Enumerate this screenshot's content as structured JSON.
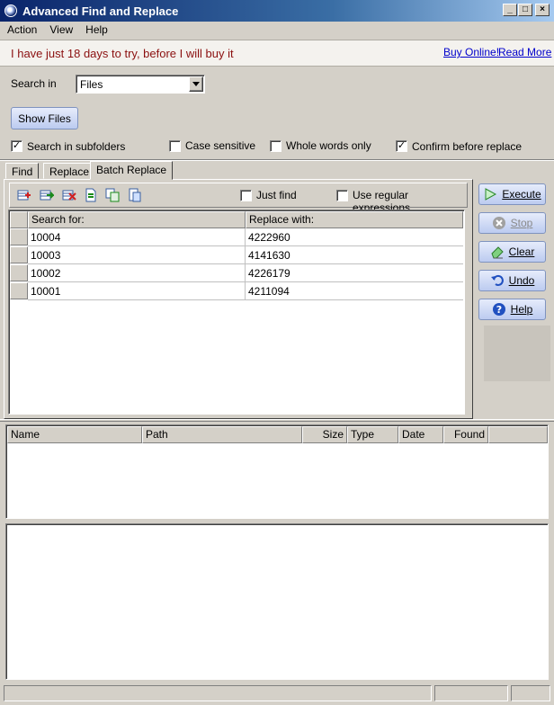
{
  "window": {
    "title": "Advanced Find and Replace"
  },
  "menu": [
    "Action",
    "View",
    "Help"
  ],
  "promo": {
    "text": "I have just 18 days to try, before I will buy it",
    "buy_link": "Buy Online!",
    "read_link": "Read More"
  },
  "search": {
    "label": "Search in",
    "value": "Files",
    "show_files": "Show Files"
  },
  "options": {
    "subfolders": "Search in subfolders",
    "case_sensitive": "Case sensitive",
    "whole_words": "Whole words only",
    "confirm": "Confirm before replace",
    "subfolders_checked": true,
    "case_checked": false,
    "whole_checked": false,
    "confirm_checked": true
  },
  "tabs": [
    "Find",
    "Replace",
    "Batch Replace"
  ],
  "active_tab": "Batch Replace",
  "batch": {
    "just_find": "Just find",
    "regex": "Use regular expressions",
    "col_search": "Search for:",
    "col_replace": "Replace with:",
    "rows": [
      {
        "search": "10004",
        "replace": "4222960"
      },
      {
        "search": "10003",
        "replace": "4141630"
      },
      {
        "search": "10002",
        "replace": "4226179"
      },
      {
        "search": "10001",
        "replace": "4211094"
      }
    ]
  },
  "actions": {
    "execute": "Execute",
    "stop": "Stop",
    "clear": "Clear",
    "undo": "Undo",
    "help": "Help"
  },
  "results": {
    "columns": [
      "Name",
      "Path",
      "Size",
      "Type",
      "Date",
      "Found"
    ]
  },
  "colors": {
    "title_start": "#0a246a",
    "title_end": "#a6caf0",
    "promo_text": "#8b1010",
    "link": "#0000cc",
    "face": "#d4d0c8"
  }
}
